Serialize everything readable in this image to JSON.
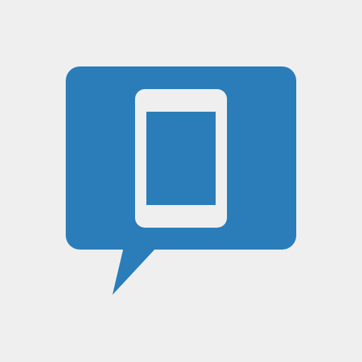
{
  "icon": {
    "name": "phone-message-icon",
    "bubble": "speech-bubble",
    "symbol": "smartphone"
  },
  "colors": {
    "background": "#efefef",
    "bubble": "#2a7db9",
    "phone_body": "#efefef",
    "phone_screen": "#2a7db9"
  }
}
